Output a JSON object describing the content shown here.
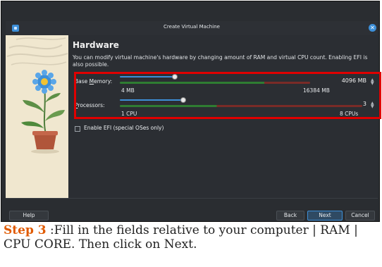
{
  "window": {
    "title": "Create Virtual Machine"
  },
  "page": {
    "heading": "Hardware",
    "description": "You can modify virtual machine's hardware by changing amount of RAM and virtual CPU count. Enabling EFI is also possible."
  },
  "memory": {
    "label_prefix": "Base ",
    "label_accel": "M",
    "label_suffix": "emory:",
    "value": "4096 MB",
    "min_label": "4 MB",
    "max_label": "16384 MB",
    "level": 0.25
  },
  "cpu": {
    "label_prefix": "",
    "label_accel": "P",
    "label_suffix": "rocessors:",
    "value": "3",
    "min_label": "1 CPU",
    "max_label": "8 CPUs",
    "level": 0.286
  },
  "efi": {
    "label": "Enable EFI (special OSes only)",
    "checked": false
  },
  "footer": {
    "help": "Help",
    "back": "Back",
    "next": "Next",
    "cancel": "Cancel"
  },
  "caption": {
    "step": "Step 3",
    "text": " :Fill in the fields relative to your computer | RAM | CPU CORE. Then click on Next."
  },
  "colors": {
    "accent": "#3d8fd8",
    "highlight": "#e00000",
    "step": "#e05a00",
    "track_green": "#2f7d32",
    "track_red": "#7a2b27"
  }
}
